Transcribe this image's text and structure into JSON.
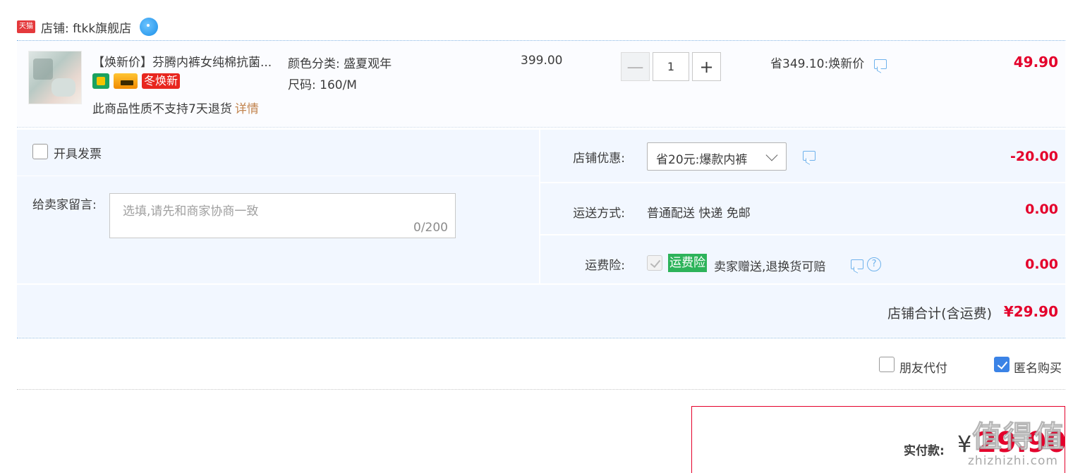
{
  "shop": {
    "badge": "天猫",
    "name": "店铺: ftkk旗舰店"
  },
  "item": {
    "title": "【焕新价】芬腾内裤女纯棉抗菌...",
    "promo_badge": "冬焕新",
    "no_return": "此商品性质不支持7天退货",
    "detail_link": "详情",
    "sku_color": "颜色分类: 盛夏观年",
    "sku_size": "尺码: 160/M",
    "original_price": "399.00",
    "quantity": "1",
    "minus": "—",
    "plus": "+",
    "saving": "省349.10:焕新价",
    "price": "49.90"
  },
  "invoice": {
    "label": "开具发票"
  },
  "note": {
    "label": "给卖家留言:",
    "placeholder": "选填,请先和商家协商一致",
    "count": "0/200"
  },
  "shop_coupon": {
    "label": "店铺优惠:",
    "selected": "省20元:爆款内裤",
    "value": "-20.00"
  },
  "delivery": {
    "label": "运送方式:",
    "method": "普通配送 快递 免邮",
    "value": "0.00"
  },
  "insurance": {
    "label": "运费险:",
    "tag": "运费险",
    "text": "卖家赠送,退换货可赔",
    "value": "0.00"
  },
  "shop_total": {
    "label": "店铺合计(含运费)",
    "value": "¥29.90"
  },
  "options": {
    "friend_pay": "朋友代付",
    "friend_pay_checked": false,
    "anonymous": "匿名购买",
    "anonymous_checked": true
  },
  "payment": {
    "label": "实付款:",
    "currency": "¥",
    "amount": "29.90"
  },
  "watermark": {
    "main": "值得值",
    "sub": "zhizhizhi.com"
  },
  "colors": {
    "accent_red": "#e4002b",
    "panel_blue": "#f2f7ff",
    "checkbox_blue": "#3b83e6",
    "insurance_green": "#2db35a"
  }
}
